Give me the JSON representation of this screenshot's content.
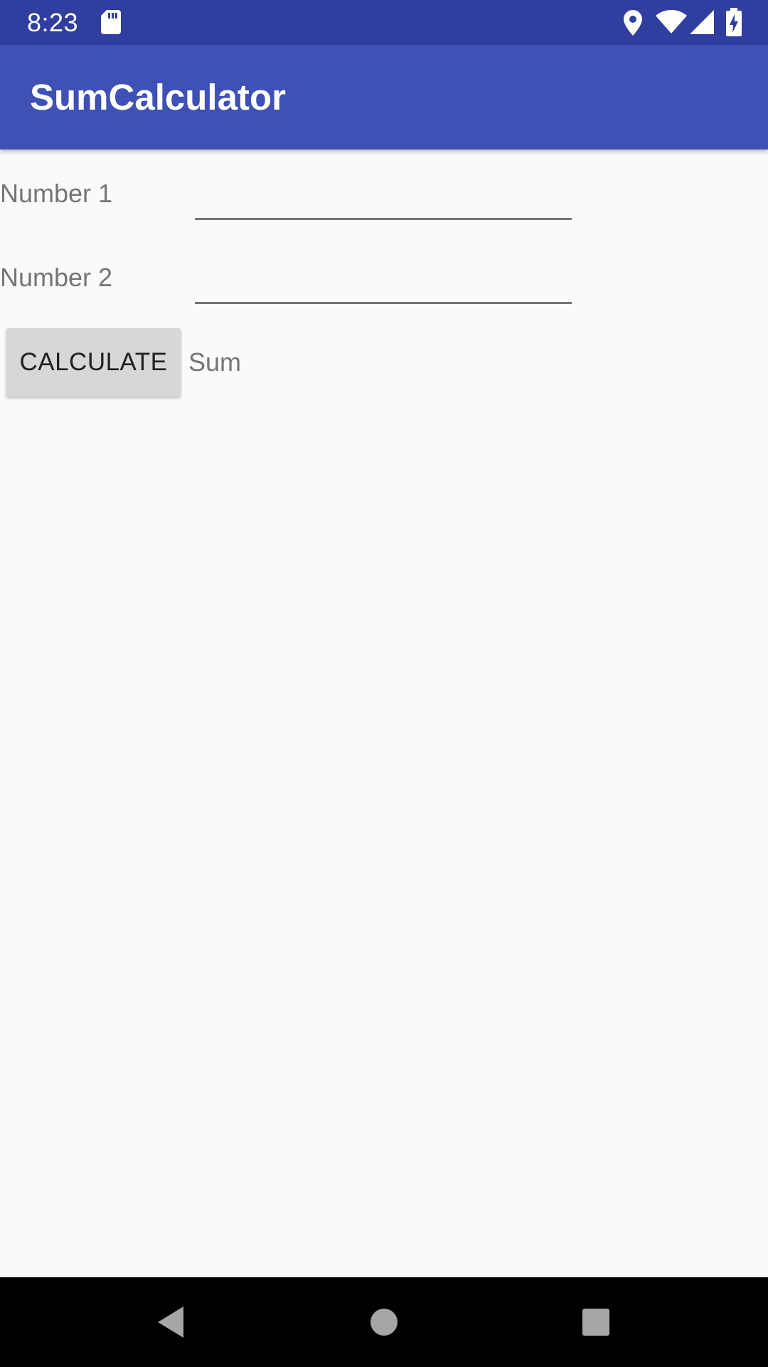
{
  "status_bar": {
    "time": "8:23",
    "icons": [
      "sd-card-icon",
      "location-icon",
      "wifi-icon",
      "cell-signal-icon",
      "battery-charging-icon"
    ]
  },
  "app_bar": {
    "title": "SumCalculator"
  },
  "form": {
    "number1_label": "Number 1",
    "number1_value": "",
    "number2_label": "Number 2",
    "number2_value": "",
    "calculate_label": "CALCULATE",
    "sum_label": "Sum"
  },
  "nav_bar": {
    "buttons": [
      "back-icon",
      "home-icon",
      "recents-icon"
    ]
  },
  "colors": {
    "primary": "#3f51b5",
    "primary_dark": "#303f9f",
    "background": "#fafafa",
    "button": "#d6d7d7",
    "secondary_text": "#757575"
  }
}
